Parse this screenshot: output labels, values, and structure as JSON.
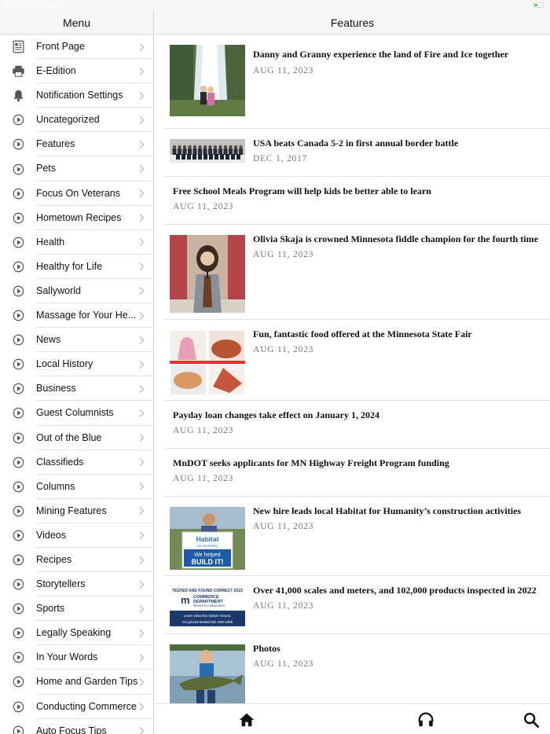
{
  "status": {
    "time": "12:34",
    "date": "Mon Aug 14"
  },
  "sidebar": {
    "title": "Menu",
    "items": [
      {
        "label": "Front Page",
        "icon": "document-icon"
      },
      {
        "label": "E-Edition",
        "icon": "printer-icon"
      },
      {
        "label": "Notification Settings",
        "icon": "bell-icon"
      },
      {
        "label": "Uncategorized",
        "icon": "play-circle-icon"
      },
      {
        "label": "Features",
        "icon": "play-circle-icon"
      },
      {
        "label": "Pets",
        "icon": "play-circle-icon"
      },
      {
        "label": "Focus On Veterans",
        "icon": "play-circle-icon"
      },
      {
        "label": "Hometown Recipes",
        "icon": "play-circle-icon"
      },
      {
        "label": "Health",
        "icon": "play-circle-icon"
      },
      {
        "label": "Healthy for Life",
        "icon": "play-circle-icon"
      },
      {
        "label": "Sallyworld",
        "icon": "play-circle-icon"
      },
      {
        "label": "Massage for Your He...",
        "icon": "play-circle-icon"
      },
      {
        "label": "News",
        "icon": "play-circle-icon"
      },
      {
        "label": "Local History",
        "icon": "play-circle-icon"
      },
      {
        "label": "Business",
        "icon": "play-circle-icon"
      },
      {
        "label": "Guest Columnists",
        "icon": "play-circle-icon"
      },
      {
        "label": "Out of the Blue",
        "icon": "play-circle-icon"
      },
      {
        "label": "Classifieds",
        "icon": "play-circle-icon"
      },
      {
        "label": "Columns",
        "icon": "play-circle-icon"
      },
      {
        "label": "Mining Features",
        "icon": "play-circle-icon"
      },
      {
        "label": "Videos",
        "icon": "play-circle-icon"
      },
      {
        "label": "Recipes",
        "icon": "play-circle-icon"
      },
      {
        "label": "Storytellers",
        "icon": "play-circle-icon"
      },
      {
        "label": "Sports",
        "icon": "play-circle-icon"
      },
      {
        "label": "Legally Speaking",
        "icon": "play-circle-icon"
      },
      {
        "label": "In Your Words",
        "icon": "play-circle-icon"
      },
      {
        "label": "Home and Garden Tips",
        "icon": "play-circle-icon"
      },
      {
        "label": "Conducting Commerce",
        "icon": "play-circle-icon"
      },
      {
        "label": "Auto Focus Tips",
        "icon": "play-circle-icon"
      }
    ]
  },
  "main": {
    "title": "Features",
    "articles": [
      {
        "title": "Danny and Granny experience the land of Fire and Ice together",
        "date": "AUG 11, 2023",
        "image": "waterfall"
      },
      {
        "title": "USA beats Canada 5-2 in first annual border battle",
        "date": "DEC 1, 2017",
        "image": "team"
      },
      {
        "title": "Free School Meals Program will help kids be better able to learn",
        "date": "AUG 11, 2023",
        "image": ""
      },
      {
        "title": "Olivia Skaja is crowned Minnesota fiddle champion for the fourth time",
        "date": "AUG 11, 2023",
        "image": "fiddle"
      },
      {
        "title": "Fun, fantastic food offered at the Minnesota State Fair",
        "date": "AUG 11, 2023",
        "image": "food"
      },
      {
        "title": "Payday loan changes take effect on January 1, 2024",
        "date": "AUG 11, 2023",
        "image": ""
      },
      {
        "title": "MnDOT seeks applicants for MN Highway Freight Program funding",
        "date": "AUG 11, 2023",
        "image": ""
      },
      {
        "title": "New hire leads local Habitat for Humanity’s construction activities",
        "date": "AUG 11, 2023",
        "image": "habitat"
      },
      {
        "title": "Over 41,000 scales and meters, and 102,000 products inspected in 2022",
        "date": "AUG 11, 2023",
        "image": "commerce"
      },
      {
        "title": "Photos",
        "date": "AUG 11, 2023",
        "image": "fish"
      }
    ],
    "habitat_sign": {
      "brand": "Habitat",
      "brand_sub": "for Humanity",
      "line1": "We helped",
      "line2": "BUILD IT!"
    },
    "commerce_sticker": {
      "top": "TESTED AND FOUND CORRECT 2023",
      "dept1": "COMMERCE",
      "dept2": "DEPARTMENT",
      "dept3": "WEIGHTS & MEASURES",
      "learn": "Learn what this sticker means:",
      "url": "mn.gov/wmtested",
      "phone": "651-539-1555"
    }
  },
  "tabbar": {
    "tabs": [
      "home-icon",
      "headphones-icon",
      "search-icon"
    ]
  },
  "colors": {
    "header_bg": "#f7f7f7",
    "divider": "#e2e2e2",
    "date": "#777777",
    "icon": "#555555"
  }
}
